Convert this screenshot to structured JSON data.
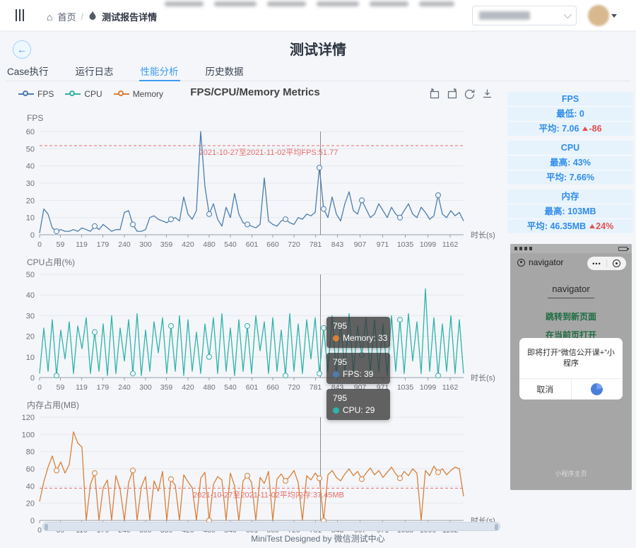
{
  "topbar": {
    "breadcrumb": {
      "home": "首页",
      "separator": "/",
      "current": "测试报告详情"
    },
    "icons": [
      "menu-icon",
      "home-icon",
      "fire-icon"
    ],
    "account_select": {
      "value_redacted": true
    }
  },
  "page": {
    "title": "测试详情",
    "back_label": "←"
  },
  "tabs": {
    "active_index": 2,
    "items": [
      {
        "label": "Case执行"
      },
      {
        "label": "运行日志"
      },
      {
        "label": "性能分析"
      },
      {
        "label": "历史数据"
      }
    ]
  },
  "legend": [
    {
      "label": "FPS",
      "color": "#4d7dae"
    },
    {
      "label": "CPU",
      "color": "#30b3ab"
    },
    {
      "label": "Memory",
      "color": "#d9803a"
    }
  ],
  "chart_data": {
    "type": "line",
    "title": "FPS/CPU/Memory Metrics",
    "x_axis_label": "时长(s)",
    "x_ticks": [
      0,
      59,
      119,
      179,
      240,
      300,
      359,
      420,
      480,
      540,
      601,
      660,
      720,
      781,
      843,
      907,
      971,
      1035,
      1099,
      1162
    ],
    "x_max": 1200,
    "x_step": 12,
    "pointer_x": 795,
    "grid": true,
    "legend_position": "top-left",
    "charts": [
      {
        "name": "FPS",
        "axis_name": "FPS",
        "ymin": 0,
        "ymax": 60,
        "ystep": 10,
        "color": "#4d7dae",
        "markline": {
          "value": 51.77,
          "label": "2021-10-27至2021-11-02平均FPS:51.77"
        },
        "values": [
          1,
          15,
          12,
          4,
          2,
          3,
          2,
          2,
          3,
          2,
          4,
          3,
          2,
          5,
          3,
          6,
          4,
          2,
          3,
          3,
          13,
          14,
          6,
          2,
          2,
          3,
          10,
          11,
          9,
          8,
          7,
          9,
          10,
          8,
          22,
          12,
          9,
          14,
          60,
          28,
          12,
          18,
          9,
          5,
          16,
          10,
          24,
          12,
          7,
          6,
          5,
          4,
          6,
          33,
          8,
          6,
          5,
          8,
          9,
          7,
          6,
          10,
          9,
          12,
          11,
          13,
          39,
          15,
          10,
          22,
          12,
          8,
          18,
          25,
          14,
          12,
          20,
          15,
          10,
          12,
          18,
          14,
          10,
          16,
          12,
          10,
          14,
          18,
          12,
          10,
          16,
          13,
          9,
          11,
          23,
          12,
          10,
          14,
          11,
          13,
          8
        ]
      },
      {
        "name": "CPU",
        "axis_name": "CPU占用(%)",
        "ymin": 0,
        "ymax": 50,
        "ystep": 10,
        "color": "#30b3ab",
        "values": [
          2,
          24,
          3,
          28,
          1,
          23,
          9,
          27,
          2,
          25,
          14,
          29,
          2,
          22,
          3,
          26,
          1,
          30,
          2,
          24,
          8,
          28,
          2,
          31,
          1,
          23,
          3,
          27,
          12,
          29,
          2,
          25,
          3,
          30,
          1,
          28,
          3,
          22,
          2,
          26,
          10,
          29,
          2,
          31,
          3,
          24,
          1,
          28,
          3,
          25,
          2,
          30,
          13,
          27,
          2,
          29,
          3,
          23,
          1,
          31,
          3,
          26,
          2,
          28,
          9,
          29,
          2,
          24,
          3,
          30,
          1,
          27,
          3,
          31,
          2,
          25,
          11,
          29,
          2,
          28,
          3,
          26,
          1,
          30,
          3,
          28,
          2,
          31,
          8,
          27,
          2,
          43,
          3,
          29,
          1,
          26,
          3,
          30,
          2,
          28,
          2
        ]
      },
      {
        "name": "Memory",
        "axis_name": "内存占用(MB)",
        "ymin": 0,
        "ymax": 120,
        "ystep": 20,
        "color": "#d9803a",
        "markline": {
          "value": 37.45,
          "label": "2021-10-27至2021-11-02平均内存:37.45MB"
        },
        "values": [
          22,
          45,
          62,
          75,
          58,
          68,
          55,
          65,
          103,
          90,
          85,
          0,
          42,
          55,
          0,
          38,
          47,
          0,
          52,
          36,
          0,
          44,
          58,
          0,
          39,
          51,
          0,
          46,
          34,
          57,
          0,
          48,
          41,
          0,
          53,
          45,
          38,
          0,
          49,
          56,
          0,
          42,
          51,
          47,
          0,
          55,
          40,
          0,
          46,
          52,
          44,
          0,
          50,
          43,
          57,
          0,
          48,
          54,
          46,
          51,
          58,
          44,
          0,
          52,
          47,
          55,
          49,
          0,
          53,
          58,
          50,
          46,
          54,
          60,
          52,
          57,
          48,
          55,
          61,
          53,
          58,
          50,
          56,
          62,
          54,
          49,
          57,
          52,
          60,
          55,
          0,
          58,
          52,
          63,
          56,
          60,
          53,
          58,
          62,
          60,
          28
        ]
      }
    ]
  },
  "tooltip": {
    "entries": [
      {
        "x": "795",
        "text": "Memory: 33",
        "color": "#d9803a"
      },
      {
        "x": "795",
        "text": "FPS: 39",
        "color": "#4d7dae"
      },
      {
        "x": "795",
        "text": "CPU: 29",
        "color": "#30b3ab"
      }
    ]
  },
  "side_stats": [
    {
      "title": "FPS",
      "rows": [
        {
          "label": "最低:",
          "value": "0"
        },
        {
          "label": "平均:",
          "value": "7.06",
          "delta": "-86"
        }
      ]
    },
    {
      "title": "CPU",
      "rows": [
        {
          "label": "最高:",
          "value": "43%"
        },
        {
          "label": "平均:",
          "value": "7.66%"
        }
      ]
    },
    {
      "title": "内存",
      "rows": [
        {
          "label": "最高:",
          "value": "103MB"
        },
        {
          "label": "平均:",
          "value": "46.35MB",
          "delta": "24%"
        }
      ]
    }
  ],
  "phone": {
    "app_title": "navigator",
    "page_title": "navigator",
    "links": [
      "跳转到新页面",
      "在当前页打开"
    ],
    "dialog": {
      "message": "即将打开“微信公开课+”小程序",
      "cancel": "取消"
    },
    "footer": "小程序主页"
  },
  "footer": {
    "text": "MiniTest Designed by 微信测试中心"
  }
}
